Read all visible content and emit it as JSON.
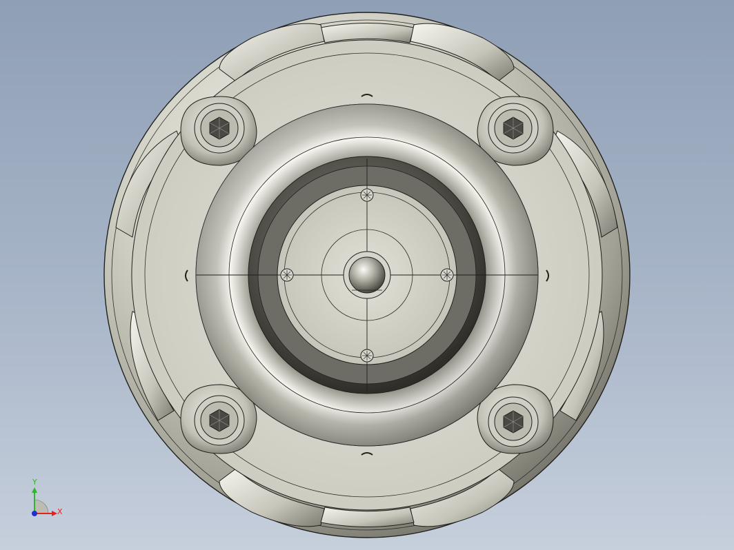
{
  "triad": {
    "x_label": "X",
    "y_label": "Y",
    "x_color": "#e8201c",
    "y_color": "#2fb52f",
    "z_color": "#1f2fd0"
  },
  "colors": {
    "background_top": "#8f9fb5",
    "background_bottom": "#c6cfdc",
    "metal_light": "#f0efe6",
    "metal_mid": "#b9b8ad",
    "metal_dark": "#5b5a52",
    "edge_line": "#1f1f1c"
  },
  "icons": {
    "fasteners": [
      "hex-socket-screw-icon",
      "hex-socket-screw-icon",
      "hex-socket-screw-icon",
      "hex-socket-screw-icon"
    ],
    "center": "ball-bearing-icon",
    "small_screws": [
      "star-screw-icon",
      "star-screw-icon",
      "star-screw-icon",
      "star-screw-icon"
    ]
  }
}
